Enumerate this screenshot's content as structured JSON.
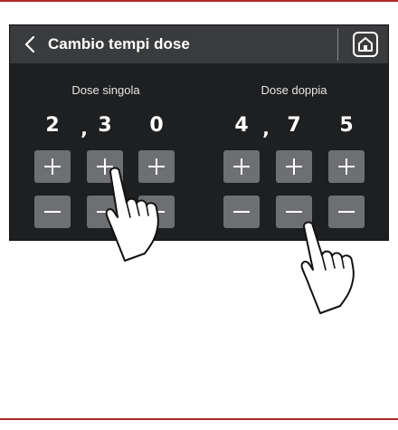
{
  "header": {
    "title": "Cambio tempi dose",
    "back_icon": "chevron-left-icon",
    "home_icon": "home-icon"
  },
  "single_dose": {
    "label": "Dose singola",
    "digits": [
      "2",
      "3",
      "0"
    ],
    "separator": ","
  },
  "double_dose": {
    "label": "Dose doppia",
    "digits": [
      "4",
      "7",
      "5"
    ],
    "separator": ","
  },
  "colors": {
    "panel_bg": "#1e1f21",
    "header_bg": "#3a3b3d",
    "button_bg": "#6e6f72",
    "rule": "#b02a2a"
  },
  "annotations": {
    "pointer_icon": "hand-pointer-icon"
  }
}
